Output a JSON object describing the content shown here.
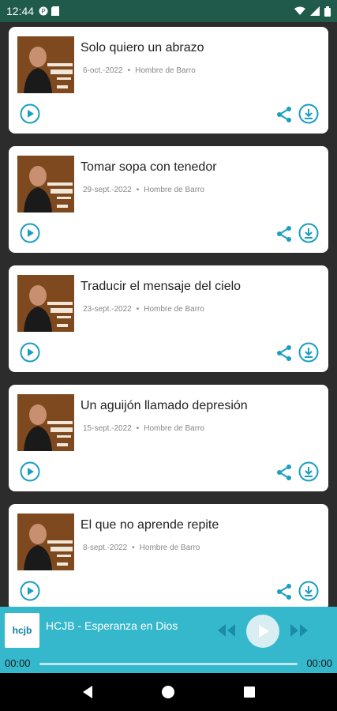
{
  "status_bar": {
    "time": "12:44",
    "icons_left": [
      "app-notification-icon",
      "storage-icon"
    ],
    "icons_right": [
      "wifi-icon",
      "signal-icon",
      "battery-icon"
    ]
  },
  "episodes": [
    {
      "title": "Solo quiero un abrazo",
      "date": "6-oct.-2022",
      "author": "Hombre de Barro"
    },
    {
      "title": "Tomar sopa con tenedor",
      "date": "29-sept.-2022",
      "author": "Hombre de Barro"
    },
    {
      "title": "Traducir el mensaje del cielo",
      "date": "23-sept.-2022",
      "author": "Hombre de Barro"
    },
    {
      "title": "Un aguijón llamado depresión",
      "date": "15-sept.-2022",
      "author": "Hombre de Barro"
    },
    {
      "title": "El que no aprende repite",
      "date": "8-sept.-2022",
      "author": "Hombre de Barro"
    }
  ],
  "player": {
    "artwork_text": "hcjb",
    "title": "HCJB - Esperanza en Dios",
    "time_elapsed": "00:00",
    "time_total": "00:00",
    "progress": 0
  },
  "colors": {
    "accent": "#1a9fc0",
    "player_bg": "#36b8cc",
    "status_bar_bg": "#1f5a4b"
  }
}
